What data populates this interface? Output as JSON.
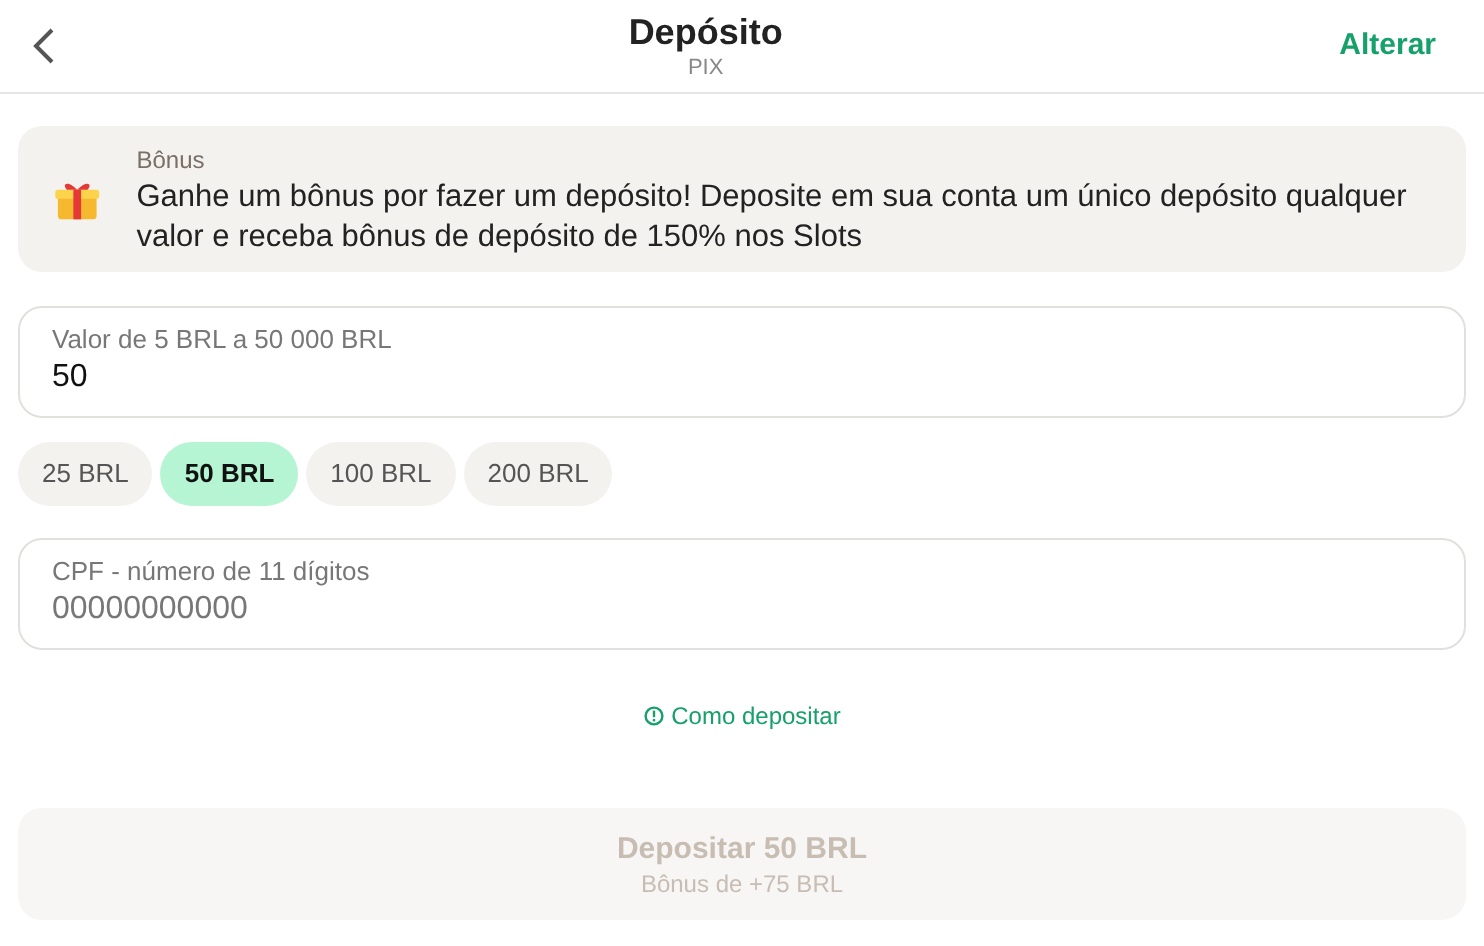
{
  "header": {
    "title": "Depósito",
    "subtitle": "PIX",
    "action": "Alterar"
  },
  "bonus": {
    "label": "Bônus",
    "text": "Ganhe um bônus por fazer um depósito! Deposite em sua conta um único depósito qualquer valor e receba bônus de depósito de 150% nos Slots"
  },
  "amount_field": {
    "label": "Valor de 5 BRL a 50 000 BRL",
    "value": "50"
  },
  "presets": [
    {
      "label": "25 BRL",
      "selected": false
    },
    {
      "label": "50 BRL",
      "selected": true
    },
    {
      "label": "100 BRL",
      "selected": false
    },
    {
      "label": "200 BRL",
      "selected": false
    }
  ],
  "cpf_field": {
    "label": "CPF - número de 11 dígitos",
    "placeholder": "00000000000"
  },
  "help_link": "Como depositar",
  "submit": {
    "label": "Depositar 50 BRL",
    "sublabel": "Bônus de +75 BRL",
    "disabled": true
  }
}
